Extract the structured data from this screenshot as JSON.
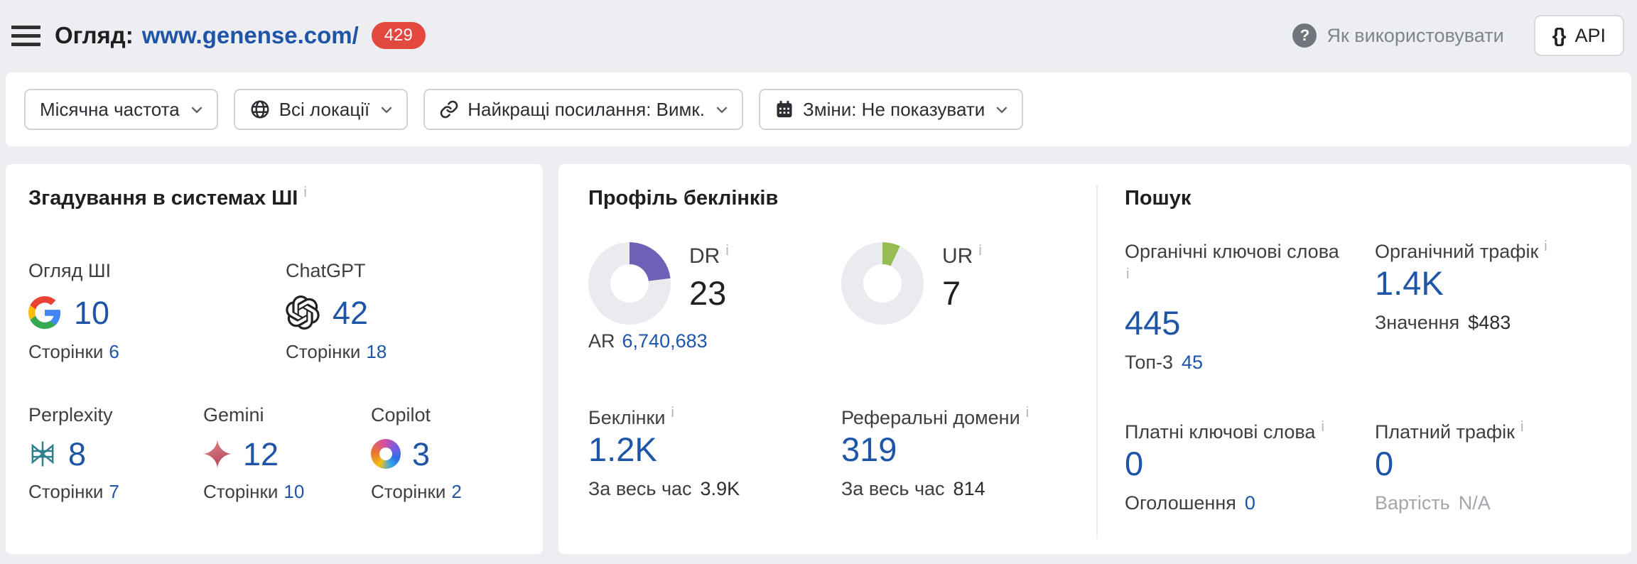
{
  "ui": {
    "info_glyph": "i"
  },
  "colors": {
    "accent_blue": "#1e55a8",
    "badge_red": "#e2483d",
    "donut_track": "#e9ebef",
    "dr_color": "#6e61b5",
    "ur_color": "#97bd52"
  },
  "header": {
    "title_label": "Огляд:",
    "domain": "www.genense.com/",
    "badge": "429",
    "help_label": "Як використовувати",
    "api_braces": "{}",
    "api_label": "API"
  },
  "filters": [
    {
      "label": "Місячна частота"
    },
    {
      "label": "Всі локації"
    },
    {
      "label": "Найкращі посилання: Вимк."
    },
    {
      "label": "Зміни: Не показувати"
    }
  ],
  "cards": {
    "ai_mentions": {
      "title": "Згадування в системах ШІ",
      "items": [
        {
          "name": "Огляд ШІ",
          "value": "10",
          "sub_label": "Сторінки",
          "sub_value": "6"
        },
        {
          "name": "ChatGPT",
          "value": "42",
          "sub_label": "Сторінки",
          "sub_value": "18"
        },
        {
          "name": "Perplexity",
          "value": "8",
          "sub_label": "Сторінки",
          "sub_value": "7"
        },
        {
          "name": "Gemini",
          "value": "12",
          "sub_label": "Сторінки",
          "sub_value": "10"
        },
        {
          "name": "Copilot",
          "value": "3",
          "sub_label": "Сторінки",
          "sub_value": "2"
        }
      ]
    },
    "backlinks": {
      "title": "Профіль беклінків",
      "dr": {
        "label": "DR",
        "value": "23",
        "percent": 23,
        "color": "#6e61b5"
      },
      "ur": {
        "label": "UR",
        "value": "7",
        "percent": 7,
        "color": "#97bd52"
      },
      "ar": {
        "label": "AR",
        "value": "6,740,683"
      },
      "metrics": [
        {
          "label": "Беклінки",
          "value": "1.2K",
          "sub_label": "За весь час",
          "sub_value": "3.9K"
        },
        {
          "label": "Реферальні домени",
          "value": "319",
          "sub_label": "За весь час",
          "sub_value": "814"
        }
      ]
    },
    "search": {
      "title": "Пошук",
      "metrics": [
        {
          "label": "Органічні ключові слова",
          "value": "445",
          "sub_label": "Топ-3",
          "sub_value": "45"
        },
        {
          "label": "Органічний трафік",
          "value": "1.4K",
          "sub_label": "Значення",
          "sub_value": "$483"
        },
        {
          "label": "Платні ключові слова",
          "value": "0",
          "sub_label": "Оголошення",
          "sub_value": "0"
        },
        {
          "label": "Платний трафік",
          "value": "0",
          "sub_label": "Вартість",
          "sub_value": "N/A"
        }
      ]
    }
  }
}
